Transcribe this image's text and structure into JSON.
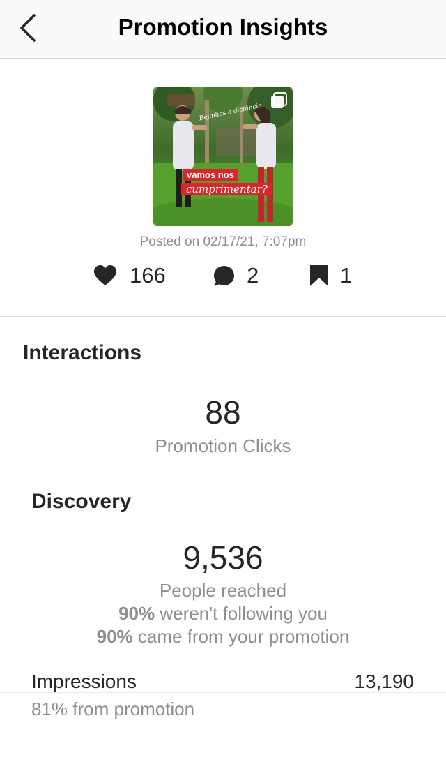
{
  "header": {
    "title": "Promotion Insights",
    "back_icon": "chevron-left-icon"
  },
  "post": {
    "image_text_line1": "vamos nos",
    "image_text_line2": "cumprimentar?",
    "image_handwriting": "Bejinhos à distância",
    "posted_on": "Posted on 02/17/21, 7:07pm",
    "likes": "166",
    "comments": "2",
    "saves": "1",
    "colors": {
      "caption_bg": "#d8262e",
      "grass": "#4f9a2c"
    }
  },
  "interactions": {
    "title": "Interactions",
    "value": "88",
    "label": "Promotion Clicks"
  },
  "discovery": {
    "title": "Discovery",
    "value": "9,536",
    "label": "People reached",
    "not_following_pct": "90%",
    "not_following_text": "weren't following you",
    "from_promotion_pct": "90%",
    "from_promotion_text": "came from your promotion",
    "impressions_label": "Impressions",
    "impressions_value": "13,190",
    "impressions_sub": "81% from promotion"
  }
}
